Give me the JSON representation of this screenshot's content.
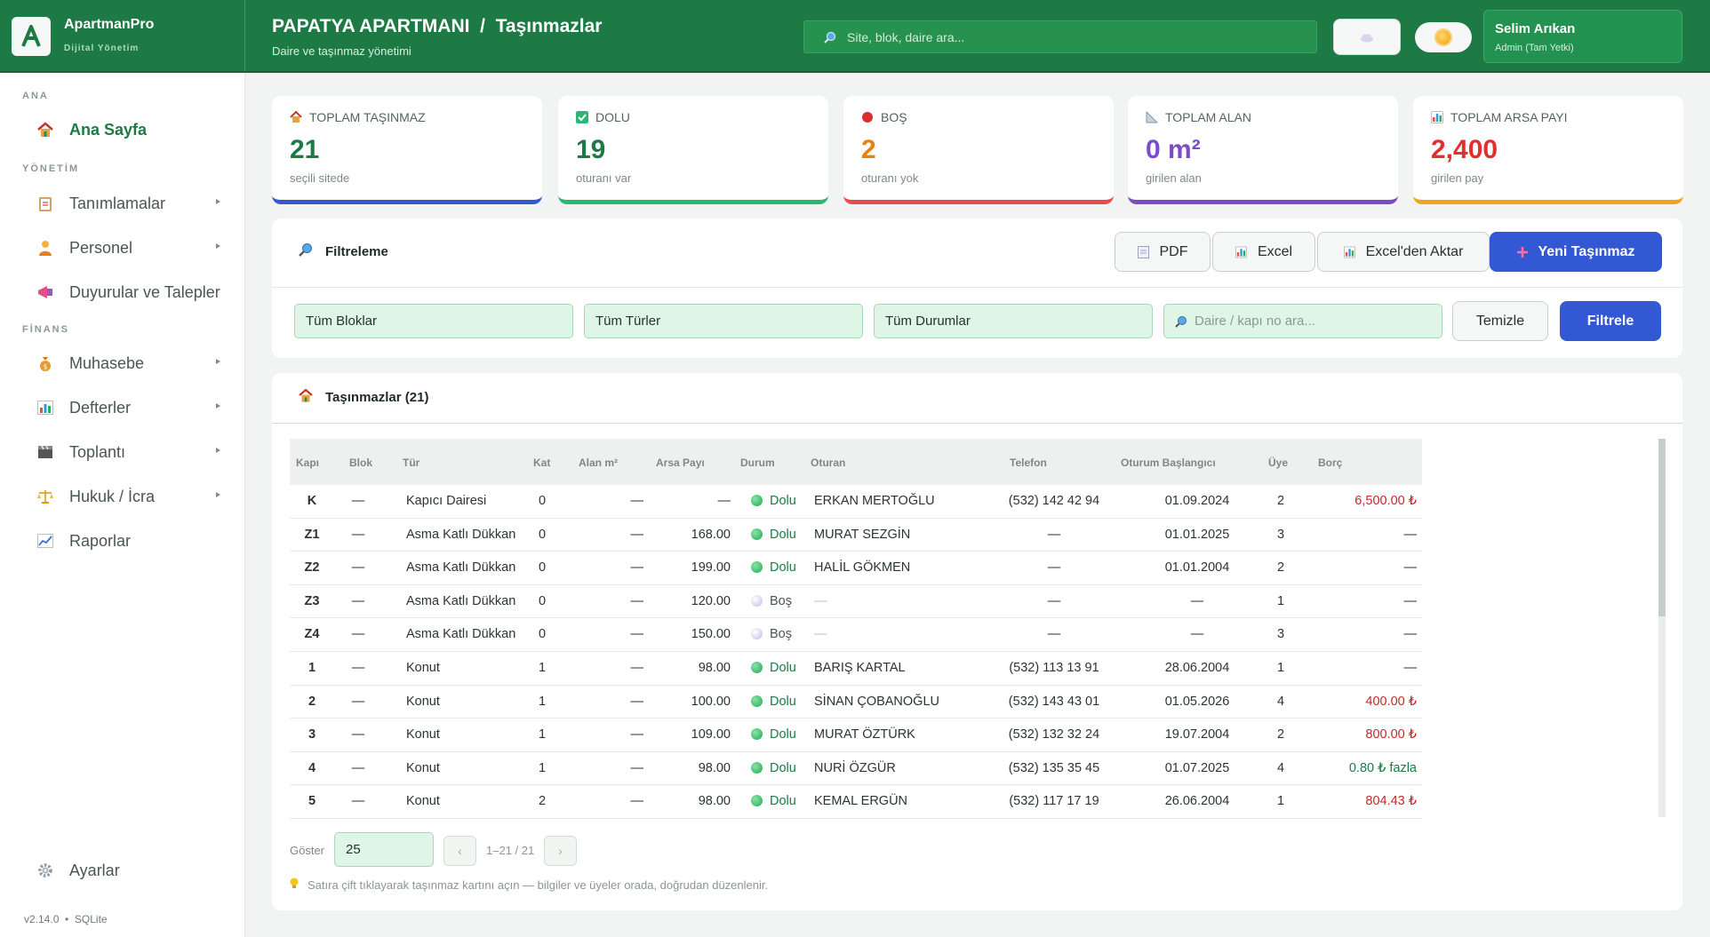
{
  "brand": {
    "name": "ApartmanPro",
    "sub": "Dijital Yönetim"
  },
  "header": {
    "title": "PAPATYA APARTMANI  /  Taşınmazlar",
    "subtitle": "Daire ve taşınmaz yönetimi",
    "search_placeholder": "Site, blok, daire ara...",
    "user_name": "Selim Arıkan",
    "user_role": "Admin (Tam Yetki)"
  },
  "sidebar": {
    "sections": [
      "ANA",
      "YÖNETİM",
      "FİNANS"
    ],
    "items": [
      {
        "label": "Ana Sayfa",
        "icon": "home-icon"
      },
      {
        "label": "Tanımlamalar",
        "icon": "clipboard-icon"
      },
      {
        "label": "Personel",
        "icon": "person-icon"
      },
      {
        "label": "Duyurular ve Talepler",
        "icon": "megaphone-icon"
      },
      {
        "label": "Muhasebe",
        "icon": "money-bag-icon"
      },
      {
        "label": "Defterler",
        "icon": "bar-chart-icon"
      },
      {
        "label": "Toplantı",
        "icon": "clapper-icon"
      },
      {
        "label": "Hukuk / İcra",
        "icon": "scales-icon"
      },
      {
        "label": "Raporlar",
        "icon": "line-chart-icon"
      },
      {
        "label": "Ayarlar",
        "icon": "gear-icon"
      }
    ],
    "version": "v2.14.0  •  SQLite"
  },
  "stats": [
    {
      "title": "TOPLAM TAŞINMAZ",
      "value": "21",
      "note": "seçili sitede",
      "color": "#1d7a45",
      "bar": "#3358d4"
    },
    {
      "title": "DOLU",
      "value": "19",
      "note": "oturanı var",
      "color": "#1d7a45",
      "bar": "#2cb673"
    },
    {
      "title": "BOŞ",
      "value": "2",
      "note": "oturanı yok",
      "color": "#e8820c",
      "bar": "#e84c4c"
    },
    {
      "title": "TOPLAM ALAN",
      "value": "0 m²",
      "note": "girilen alan",
      "color": "#7b4bc9",
      "bar": "#7b4bc9"
    },
    {
      "title": "TOPLAM ARSA PAYI",
      "value": "2,400",
      "note": "girilen pay",
      "color": "#e0302f",
      "bar": "#f2a516"
    }
  ],
  "filter": {
    "title": "Filtreleme",
    "pdf": "PDF",
    "excel": "Excel",
    "excel_import": "Excel'den Aktar",
    "new": "Yeni Taşınmaz",
    "blocks": "Tüm Bloklar",
    "types": "Tüm Türler",
    "statuses": "Tüm Durumlar",
    "search_placeholder": "Daire / kapı no ara...",
    "clear": "Temizle",
    "apply": "Filtrele"
  },
  "table": {
    "title": "Taşınmazlar (21)",
    "columns": [
      "Kapı",
      "Blok",
      "Tür",
      "Kat",
      "Alan m²",
      "Arsa Payı",
      "Durum",
      "Oturan",
      "Telefon",
      "Oturum Başlangıcı",
      "Üye",
      "Borç"
    ],
    "rows": [
      {
        "kapi": "K",
        "blok": "—",
        "tur": "Kapıcı Dairesi",
        "kat": "0",
        "alan": "—",
        "arsa": "—",
        "durum": "Dolu",
        "oturan": "ERKAN MERTOĞLU",
        "tel": "(532) 142 42 94",
        "bas": "01.09.2024",
        "uye": "2",
        "borc": "6,500.00 ₺",
        "borc_type": "debt"
      },
      {
        "kapi": "Z1",
        "blok": "—",
        "tur": "Asma Katlı Dükkan",
        "kat": "0",
        "alan": "—",
        "arsa": "168.00",
        "durum": "Dolu",
        "oturan": "MURAT SEZGİN",
        "tel": "—",
        "bas": "01.01.2025",
        "uye": "3",
        "borc": "—",
        "borc_type": "none"
      },
      {
        "kapi": "Z2",
        "blok": "—",
        "tur": "Asma Katlı Dükkan",
        "kat": "0",
        "alan": "—",
        "arsa": "199.00",
        "durum": "Dolu",
        "oturan": "HALİL GÖKMEN",
        "tel": "—",
        "bas": "01.01.2004",
        "uye": "2",
        "borc": "—",
        "borc_type": "none"
      },
      {
        "kapi": "Z3",
        "blok": "—",
        "tur": "Asma Katlı Dükkan",
        "kat": "0",
        "alan": "—",
        "arsa": "120.00",
        "durum": "Boş",
        "oturan": "—",
        "tel": "—",
        "bas": "—",
        "uye": "1",
        "borc": "—",
        "borc_type": "none"
      },
      {
        "kapi": "Z4",
        "blok": "—",
        "tur": "Asma Katlı Dükkan",
        "kat": "0",
        "alan": "—",
        "arsa": "150.00",
        "durum": "Boş",
        "oturan": "—",
        "tel": "—",
        "bas": "—",
        "uye": "3",
        "borc": "—",
        "borc_type": "none"
      },
      {
        "kapi": "1",
        "blok": "—",
        "tur": "Konut",
        "kat": "1",
        "alan": "—",
        "arsa": "98.00",
        "durum": "Dolu",
        "oturan": "BARIŞ KARTAL",
        "tel": "(532) 113 13 91",
        "bas": "28.06.2004",
        "uye": "1",
        "borc": "—",
        "borc_type": "none"
      },
      {
        "kapi": "2",
        "blok": "—",
        "tur": "Konut",
        "kat": "1",
        "alan": "—",
        "arsa": "100.00",
        "durum": "Dolu",
        "oturan": "SİNAN ÇOBANOĞLU",
        "tel": "(532) 143 43 01",
        "bas": "01.05.2026",
        "uye": "4",
        "borc": "400.00 ₺",
        "borc_type": "debt"
      },
      {
        "kapi": "3",
        "blok": "—",
        "tur": "Konut",
        "kat": "1",
        "alan": "—",
        "arsa": "109.00",
        "durum": "Dolu",
        "oturan": "MURAT ÖZTÜRK",
        "tel": "(532) 132 32 24",
        "bas": "19.07.2004",
        "uye": "2",
        "borc": "800.00 ₺",
        "borc_type": "debt"
      },
      {
        "kapi": "4",
        "blok": "—",
        "tur": "Konut",
        "kat": "1",
        "alan": "—",
        "arsa": "98.00",
        "durum": "Dolu",
        "oturan": "NURİ ÖZGÜR",
        "tel": "(532) 135 35 45",
        "bas": "01.07.2025",
        "uye": "4",
        "borc": "0.80 ₺ fazla",
        "borc_type": "credit"
      },
      {
        "kapi": "5",
        "blok": "—",
        "tur": "Konut",
        "kat": "2",
        "alan": "—",
        "arsa": "98.00",
        "durum": "Dolu",
        "oturan": "KEMAL ERGÜN",
        "tel": "(532) 117 17 19",
        "bas": "26.06.2004",
        "uye": "1",
        "borc": "804.43 ₺",
        "borc_type": "debt"
      }
    ],
    "pager_label": "Göster",
    "page_size": "25",
    "page_info": "1–21 / 21",
    "hint": "Satıra çift tıklayarak taşınmaz kartını açın — bilgiler ve üyeler orada, doğrudan düzenlenir."
  },
  "colors": {
    "primary": "#1d7a45",
    "accent": "#3358d4",
    "debt": "#c62828",
    "credit": "#1d7a45"
  }
}
